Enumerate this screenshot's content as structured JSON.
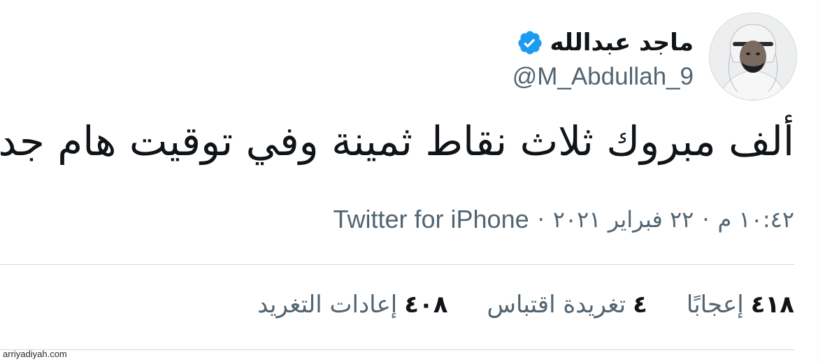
{
  "tweet": {
    "author": {
      "display_name": "ماجد عبدالله",
      "handle": "@M_Abdullah_9",
      "verified": true,
      "verified_icon": "verified-badge-icon",
      "avatar_icon": "avatar"
    },
    "text": "ألف مبروك ثلاث نقاط ثمينة وفي توقيت هام جداً",
    "meta": {
      "time": "١٠:٤٢ م",
      "separator": "·",
      "date": "٢٢ فبراير ٢٠٢١",
      "source": "Twitter for iPhone"
    },
    "stats": [
      {
        "num": "٤٠٨",
        "label": "إعادات التغريد"
      },
      {
        "num": "٤",
        "label": "تغريدة اقتباس"
      },
      {
        "num": "٤١٨",
        "label": "إعجابًا"
      }
    ]
  },
  "watermark": "arriyadiyah.com",
  "colors": {
    "text_primary": "#0f1419",
    "text_secondary": "#536471",
    "verified_blue": "#1d9bf0",
    "divider": "#cfd9de",
    "background": "#ffffff"
  }
}
